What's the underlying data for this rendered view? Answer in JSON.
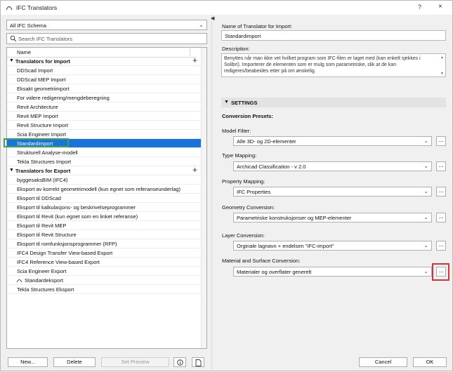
{
  "window": {
    "title": "IFC Translators",
    "help": "?",
    "close": "×"
  },
  "left": {
    "schema_select": "All IFC Schema",
    "search_placeholder": "Search IFC Translators",
    "column_header": "Name",
    "import_group": "Translators for Import",
    "import_items": [
      "DDScad Import",
      "DDScad MEP Import",
      "Eksakt geometriimport",
      "For videre redigering/mengdeberegning",
      "Revit Architecture",
      "Revit MEP Import",
      "Revit Structure Import",
      "Scia Engineer Import",
      "Standardimport",
      "Strukturell Analyse-modell",
      "Tekla Structures Import"
    ],
    "export_group": "Translators for Export",
    "export_items": [
      "byggesaksBIM (IFC4)",
      "Eksport av korrekt geometrimodell (kun egnet som referanseunderlag)",
      "Eksport til DDScad",
      "Eksport til kalkulasjons- og beskrivelseprogrammer",
      "Eksport til Revit (kun egnet som en linket referanse)",
      "Eksport til Revit MEP",
      "Eksport til Revit Structure",
      "Eksport til romfunksjonsprogrammer (RFP)",
      "IFC4 Design Transfer View-based Export",
      "IFC4 Reference View-based Export",
      "Scia Engineer Export",
      "Standardeksport",
      "Tekla Structures Eksport"
    ],
    "buttons": {
      "new": "New...",
      "delete": "Delete",
      "set_preview": "Set Preview"
    }
  },
  "right": {
    "name_label": "Name of Translator for Import:",
    "name_value": "Standardimport",
    "description_label": "Description:",
    "description": "Benyttes når man ikke vet hvilket program som IFC-filen er laget med (kan enkelt sjekkes i Solibri). Importerer de elementen som er mulg som parametriske, slik at de kan redigeres/beabeides etter på om ønskelig.",
    "settings_header": "SETTINGS",
    "presets_label": "Conversion Presets:",
    "model_filter_label": "Model Filter:",
    "model_filter_value": "Alle 3D- og 2D-elementer",
    "type_mapping_label": "Type Mapping:",
    "type_mapping_value": "Archicad Classification - v 2.0",
    "property_mapping_label": "Property Mapping:",
    "property_mapping_value": "IFC Properties",
    "geometry_label": "Geometry Conversion:",
    "geometry_value": "Parametriske konstruksjonser og MEP-elementer",
    "layer_label": "Layer Conversion:",
    "layer_value": "Orginale lagnavn + endelsen \"IFC-import\"",
    "material_label": "Material and Surface Conversion:",
    "material_value": "Materialer og overflater generelt",
    "dots": "...",
    "cancel": "Cancel",
    "ok": "OK"
  }
}
